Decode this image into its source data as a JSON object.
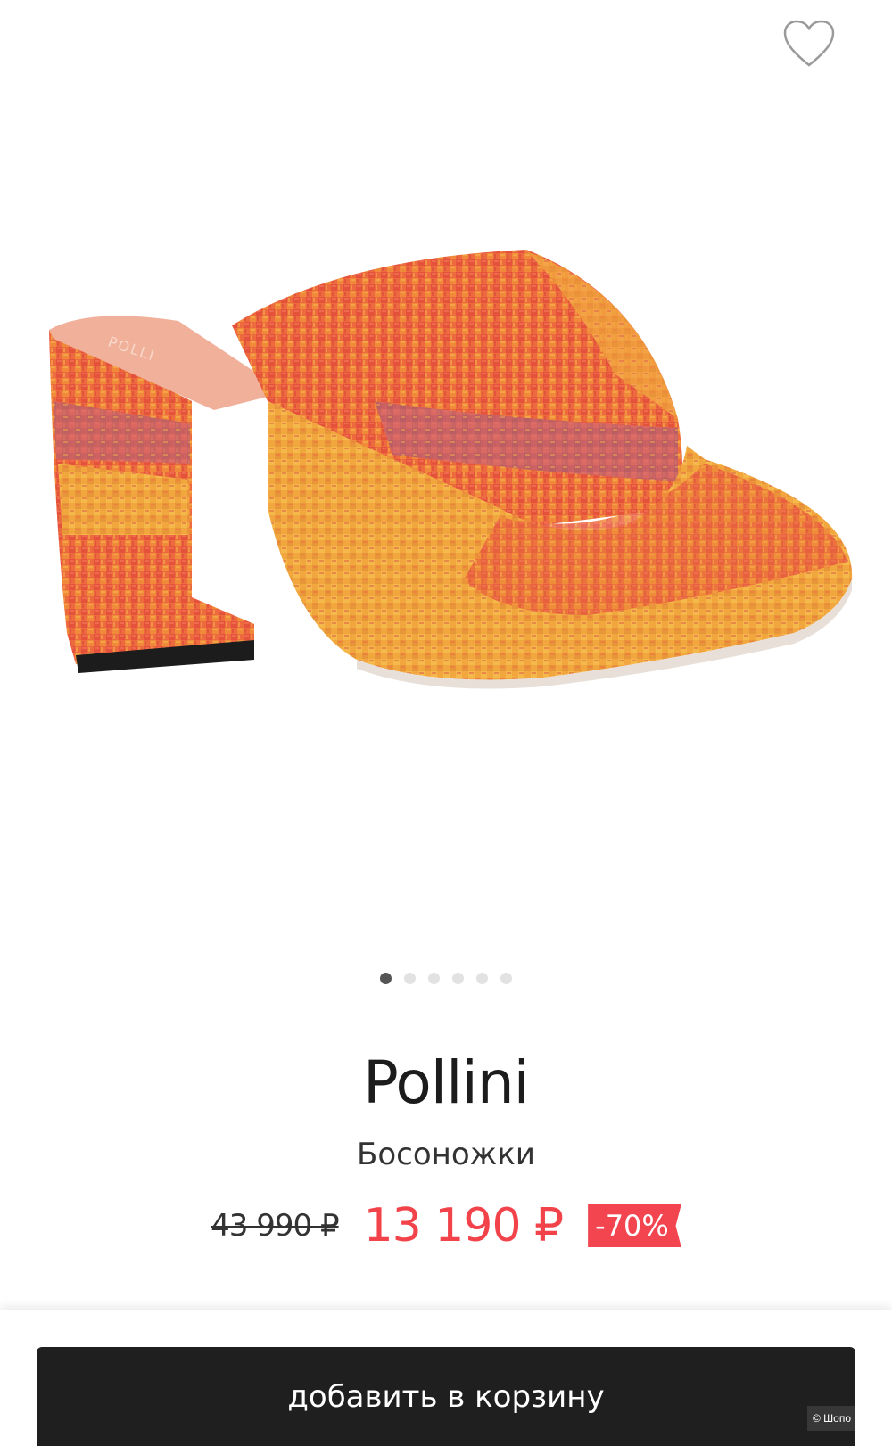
{
  "product": {
    "brand": "Pollini",
    "category": "Босоножки",
    "old_price": "43 990 ₽",
    "new_price": "13 190 ₽",
    "discount": "-70%",
    "image_icon": "sandal-product-image"
  },
  "gallery": {
    "total_images": 6,
    "active_index": 0
  },
  "actions": {
    "wishlist_icon": "heart-outline-icon",
    "add_to_cart_label": "добавить в корзину"
  },
  "watermark": "© Шопо",
  "colors": {
    "accent_price": "#f2434b",
    "discount_badge": "#f24550",
    "button": "#1f1f1f"
  }
}
